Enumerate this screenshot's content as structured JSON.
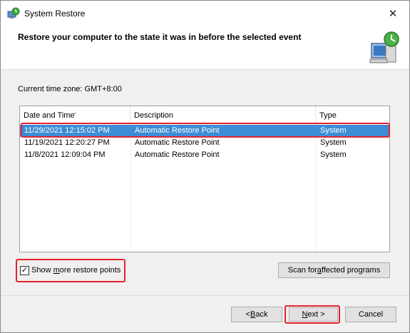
{
  "window": {
    "title": "System Restore",
    "close_glyph": "✕"
  },
  "header": {
    "title": "Restore your computer to the state it was in before the selected event"
  },
  "timezone_label": "Current time zone: GMT+8:00",
  "list": {
    "columns": [
      "Date and Time",
      "Description",
      "Type"
    ],
    "sort_glyph": "⌄",
    "rows": [
      {
        "date": "11/29/2021 12:15:02 PM",
        "description": "Automatic Restore Point",
        "type": "System",
        "selected": true
      },
      {
        "date": "11/19/2021 12:20:27 PM",
        "description": "Automatic Restore Point",
        "type": "System",
        "selected": false
      },
      {
        "date": "11/8/2021 12:09:04 PM",
        "description": "Automatic Restore Point",
        "type": "System",
        "selected": false
      }
    ]
  },
  "show_more": {
    "label_before": "Show ",
    "label_underlined": "m",
    "label_after": "ore restore points",
    "checked_glyph": "✓"
  },
  "scan_button": {
    "label_before": "Scan for ",
    "label_underlined": "a",
    "label_after": "ffected programs"
  },
  "buttons": {
    "back_before": "< ",
    "back_underlined": "B",
    "back_after": "ack",
    "next_underlined": "N",
    "next_after": "ext >",
    "cancel": "Cancel"
  },
  "colors": {
    "selection": "#3c8dd6",
    "highlight": "#e5232b"
  },
  "icons": {
    "title": "system-restore-icon",
    "header": "computer-restore-icon"
  }
}
